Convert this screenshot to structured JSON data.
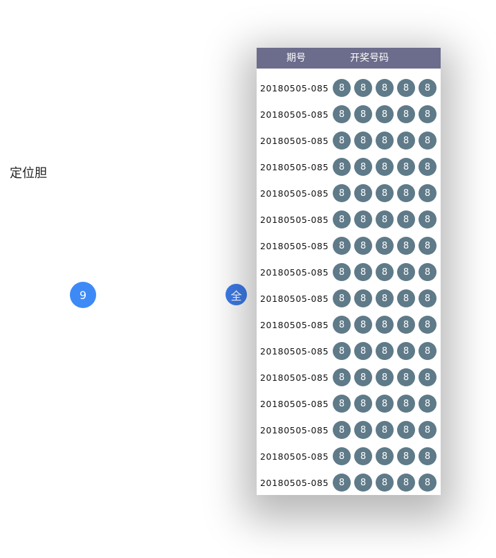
{
  "section_label": "定位胆",
  "digit_button": "9",
  "all_button": "全",
  "history": {
    "header": {
      "period": "期号",
      "numbers": "开奖号码"
    },
    "rows": [
      {
        "period": "20180505-085",
        "balls": [
          "8",
          "8",
          "8",
          "8",
          "8"
        ]
      },
      {
        "period": "20180505-085",
        "balls": [
          "8",
          "8",
          "8",
          "8",
          "8"
        ]
      },
      {
        "period": "20180505-085",
        "balls": [
          "8",
          "8",
          "8",
          "8",
          "8"
        ]
      },
      {
        "period": "20180505-085",
        "balls": [
          "8",
          "8",
          "8",
          "8",
          "8"
        ]
      },
      {
        "period": "20180505-085",
        "balls": [
          "8",
          "8",
          "8",
          "8",
          "8"
        ]
      },
      {
        "period": "20180505-085",
        "balls": [
          "8",
          "8",
          "8",
          "8",
          "8"
        ]
      },
      {
        "period": "20180505-085",
        "balls": [
          "8",
          "8",
          "8",
          "8",
          "8"
        ]
      },
      {
        "period": "20180505-085",
        "balls": [
          "8",
          "8",
          "8",
          "8",
          "8"
        ]
      },
      {
        "period": "20180505-085",
        "balls": [
          "8",
          "8",
          "8",
          "8",
          "8"
        ]
      },
      {
        "period": "20180505-085",
        "balls": [
          "8",
          "8",
          "8",
          "8",
          "8"
        ]
      },
      {
        "period": "20180505-085",
        "balls": [
          "8",
          "8",
          "8",
          "8",
          "8"
        ]
      },
      {
        "period": "20180505-085",
        "balls": [
          "8",
          "8",
          "8",
          "8",
          "8"
        ]
      },
      {
        "period": "20180505-085",
        "balls": [
          "8",
          "8",
          "8",
          "8",
          "8"
        ]
      },
      {
        "period": "20180505-085",
        "balls": [
          "8",
          "8",
          "8",
          "8",
          "8"
        ]
      },
      {
        "period": "20180505-085",
        "balls": [
          "8",
          "8",
          "8",
          "8",
          "8"
        ]
      },
      {
        "period": "20180505-085",
        "balls": [
          "8",
          "8",
          "8",
          "8",
          "8"
        ]
      }
    ]
  },
  "colors": {
    "header_bg": "#6c6c8c",
    "ball_bg": "#5f7a88",
    "accent_blue": "#3d8af7"
  }
}
